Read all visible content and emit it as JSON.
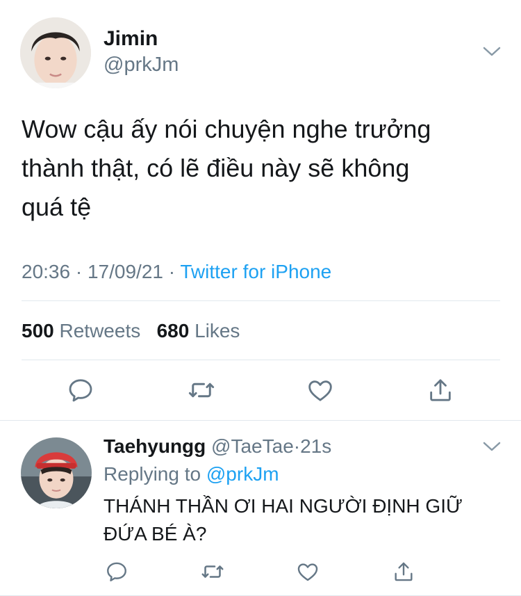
{
  "main_tweet": {
    "display_name": "Jimin",
    "handle": "@prkJm",
    "text_line1": "Wow cậu ấy nói chuyện nghe trưởng",
    "text_line2": "thành thật, có lẽ điều này sẽ không",
    "text_line3": "quá tệ",
    "time": "20:36",
    "date": "17/09/21",
    "separator": "·",
    "source": "Twitter for iPhone",
    "retweet_count": "500",
    "retweet_label": "Retweets",
    "like_count": "680",
    "like_label": "Likes"
  },
  "reply": {
    "display_name": "Taehyungg",
    "handle": "@TaeTae",
    "separator": "·",
    "age": "21s",
    "replying_prefix": "Replying to",
    "replying_to": "@prkJm",
    "text_line1": "THÁNH THẦN ƠI HAI NGƯỜI ĐỊNH GIỮ",
    "text_line2": "ĐỨA BÉ À?"
  },
  "icons": {
    "menu": "chevron-down-icon",
    "reply": "reply-icon",
    "retweet": "retweet-icon",
    "like": "heart-icon",
    "share": "share-icon"
  },
  "colors": {
    "link": "#1da1f2",
    "secondary_text": "#657786",
    "divider": "#e1e8ed",
    "icon_gray": "#657786"
  }
}
